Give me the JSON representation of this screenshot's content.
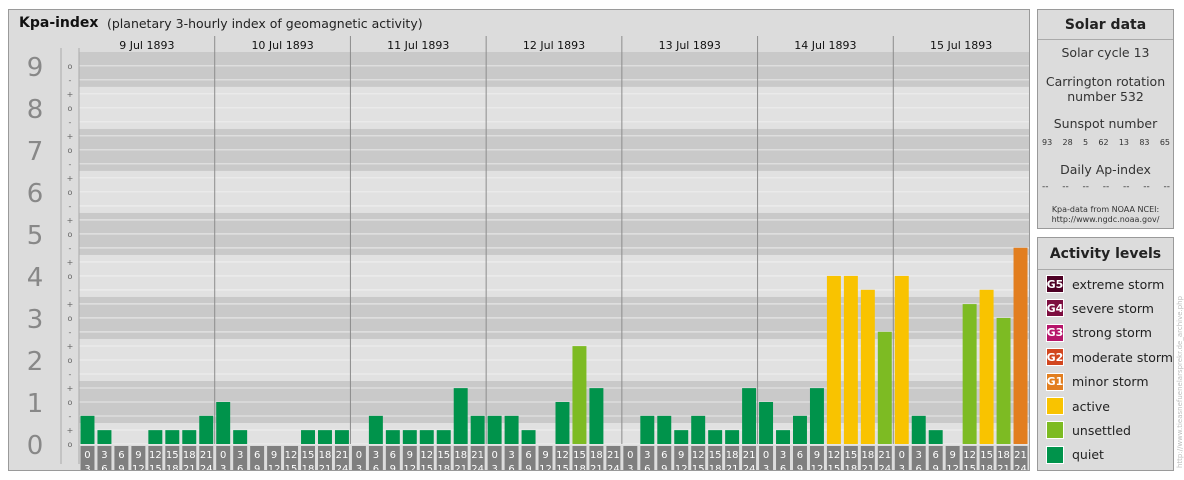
{
  "title": "Kpa-index",
  "subtitle": "(planetary 3-hourly index of geomagnetic activity)",
  "chart_data": {
    "type": "bar",
    "days": [
      "9 Jul 1893",
      "10 Jul 1893",
      "11 Jul 1893",
      "12 Jul 1893",
      "13 Jul 1893",
      "14 Jul 1893",
      "15 Jul 1893"
    ],
    "interval_start_labels": [
      "0",
      "3",
      "6",
      "9",
      "12",
      "15",
      "18",
      "21"
    ],
    "interval_end_labels": [
      "3",
      "6",
      "9",
      "12",
      "15",
      "18",
      "21",
      "24"
    ],
    "y_labels": [
      "0",
      "1",
      "2",
      "3",
      "4",
      "5",
      "6",
      "7",
      "8",
      "9"
    ],
    "minor_labels": [
      "+",
      "o",
      "-"
    ],
    "ylim": [
      0,
      9.33
    ],
    "values": [
      0.67,
      0.33,
      0,
      0,
      0.33,
      0.33,
      0.33,
      0.67,
      1.0,
      0.33,
      0,
      0,
      0,
      0.33,
      0.33,
      0.33,
      0,
      0.67,
      0.33,
      0.33,
      0.33,
      0.33,
      1.33,
      0.67,
      0.67,
      0.67,
      0.33,
      0,
      1.0,
      2.33,
      1.33,
      0,
      0,
      0.67,
      0.67,
      0.33,
      0.67,
      0.33,
      0.33,
      1.33,
      1.0,
      0.33,
      0.67,
      1.33,
      4.0,
      4.0,
      3.67,
      2.67,
      4.0,
      0.67,
      0.33,
      0,
      3.33,
      3.67,
      3.0,
      4.67
    ],
    "colors": {
      "quiet": "#00934b",
      "unsettled": "#7dbb23",
      "active": "#f9c300",
      "G1": "#e27e1f",
      "G2": "#d2461f",
      "G3": "#b6156a",
      "G4": "#7d0e40",
      "G5": "#4d0024"
    },
    "grid": true
  },
  "solar": {
    "title": "Solar data",
    "cycle": "Solar cycle 13",
    "carrington_1": "Carrington rotation",
    "carrington_2": "number 532",
    "sunspot_label": "Sunspot number",
    "sunspots": [
      "93",
      "28",
      "5",
      "62",
      "13",
      "83",
      "65"
    ],
    "ap_label": "Daily Ap-index",
    "ap_values": [
      "--",
      "--",
      "--",
      "--",
      "--",
      "--",
      "--"
    ],
    "source_1": "Kpa-data from NOAA NCEI:",
    "source_2": "http://www.ngdc.noaa.gov/"
  },
  "activity": {
    "title": "Activity levels",
    "items": [
      {
        "code": "G5",
        "label": "extreme storm",
        "color": "#4d0024"
      },
      {
        "code": "G4",
        "label": "severe storm",
        "color": "#7d0e40"
      },
      {
        "code": "G3",
        "label": "strong storm",
        "color": "#b6156a"
      },
      {
        "code": "G2",
        "label": "moderate storm",
        "color": "#d2461f"
      },
      {
        "code": "G1",
        "label": "minor storm",
        "color": "#e27e1f"
      },
      {
        "code": "",
        "label": "active",
        "color": "#f9c300"
      },
      {
        "code": "",
        "label": "unsettled",
        "color": "#7dbb23"
      },
      {
        "code": "",
        "label": "quiet",
        "color": "#00934b"
      }
    ]
  },
  "watermark": "http://www.tieasnefuenelarsprekr.de_archive.php"
}
